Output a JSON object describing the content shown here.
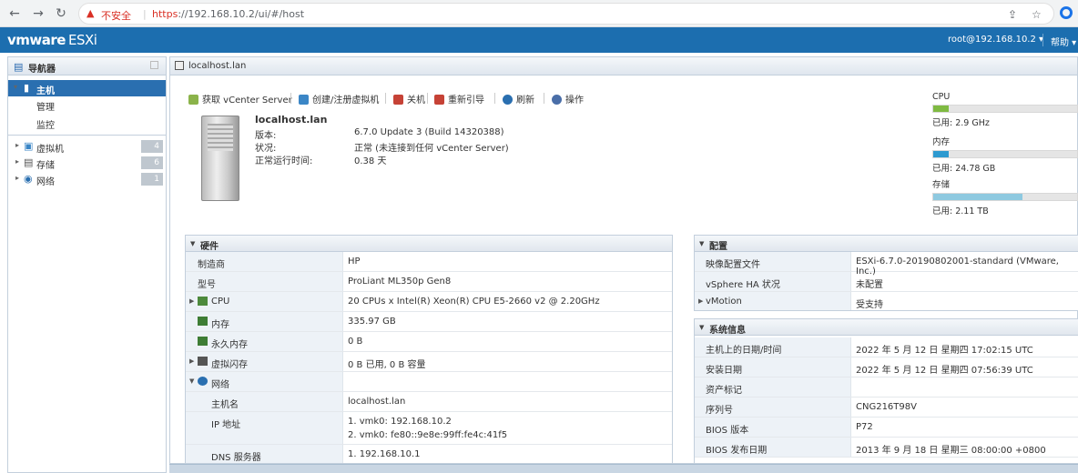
{
  "browser": {
    "insecure_label": "不安全",
    "url_proto": "https",
    "url_rest": "://192.168.10.2/ui/#/host"
  },
  "header": {
    "logo_vm": "vmware",
    "logo_esxi": "ESXi",
    "user": "root@192.168.10.2 ▾",
    "help": "帮助 ▾"
  },
  "navigator": {
    "title": "导航器",
    "items": [
      {
        "label": "主机"
      },
      {
        "label": "管理"
      },
      {
        "label": "监控"
      },
      {
        "label": "虚拟机",
        "count": "4"
      },
      {
        "label": "存储",
        "count": "6"
      },
      {
        "label": "网络",
        "count": "1"
      }
    ]
  },
  "content": {
    "tab_title": "localhost.lan",
    "toolbar": [
      {
        "label": "获取 vCenter Server",
        "color": "#8bb34a"
      },
      {
        "label": "创建/注册虚拟机",
        "color": "#3b86c6"
      },
      {
        "label": "关机",
        "color": "#c64236"
      },
      {
        "label": "重新引导",
        "color": "#c64236"
      },
      {
        "label": "刷新",
        "color": "#2a6fb0"
      },
      {
        "label": "操作",
        "color": "#4a6ea8"
      }
    ],
    "host": {
      "name": "localhost.lan",
      "fields": [
        {
          "k": "版本:",
          "v": "6.7.0 Update 3 (Build 14320388)"
        },
        {
          "k": "状况:",
          "v": "正常 (未连接到任何 vCenter Server)"
        },
        {
          "k": "正常运行时间:",
          "v": "0.38 天"
        }
      ]
    },
    "resources": [
      {
        "name": "CPU",
        "used": "已用: 2.9 GHz",
        "fill": 0.11,
        "color": "#7fba42"
      },
      {
        "name": "内存",
        "used": "已用: 24.78 GB",
        "fill": 0.11,
        "color": "#2e9ad0"
      },
      {
        "name": "存储",
        "used": "已用: 2.11 TB",
        "fill": 0.62,
        "color": "#8ec9e0"
      }
    ],
    "hardware": {
      "title": "硬件",
      "rows": [
        {
          "k": "制造商",
          "v": "HP"
        },
        {
          "k": "型号",
          "v": "ProLiant ML350p Gen8"
        },
        {
          "k": "CPU",
          "v": "20 CPUs x Intel(R) Xeon(R) CPU E5-2660 v2 @ 2.20GHz"
        },
        {
          "k": "内存",
          "v": "335.97 GB"
        },
        {
          "k": "永久内存",
          "v": "0 B"
        },
        {
          "k": "虚拟闪存",
          "v": "0 B 已用, 0 B 容量"
        },
        {
          "k": "网络",
          "v": ""
        },
        {
          "k": "主机名",
          "v": "localhost.lan"
        },
        {
          "k": "IP 地址",
          "v": "1. vmk0: 192.168.10.2",
          "v2": "2. vmk0: fe80::9e8e:99ff:fe4c:41f5"
        },
        {
          "k": "DNS 服务器",
          "v": "1. 192.168.10.1"
        }
      ]
    },
    "config": {
      "title": "配置",
      "rows": [
        {
          "k": "映像配置文件",
          "v": "ESXi-6.7.0-20190802001-standard (VMware, Inc.)"
        },
        {
          "k": "vSphere HA 状况",
          "v": "未配置"
        },
        {
          "k": "vMotion",
          "v": "受支持"
        }
      ]
    },
    "sysinfo": {
      "title": "系统信息",
      "rows": [
        {
          "k": "主机上的日期/时间",
          "v": "2022 年 5 月 12 日 星期四 17:02:15 UTC"
        },
        {
          "k": "安装日期",
          "v": "2022 年 5 月 12 日 星期四 07:56:39 UTC"
        },
        {
          "k": "资产标记",
          "v": ""
        },
        {
          "k": "序列号",
          "v": "CNG216T98V"
        },
        {
          "k": "BIOS 版本",
          "v": "P72"
        },
        {
          "k": "BIOS 发布日期",
          "v": "2013 年 9 月 18 日 星期三 08:00:00 +0800"
        }
      ]
    }
  }
}
